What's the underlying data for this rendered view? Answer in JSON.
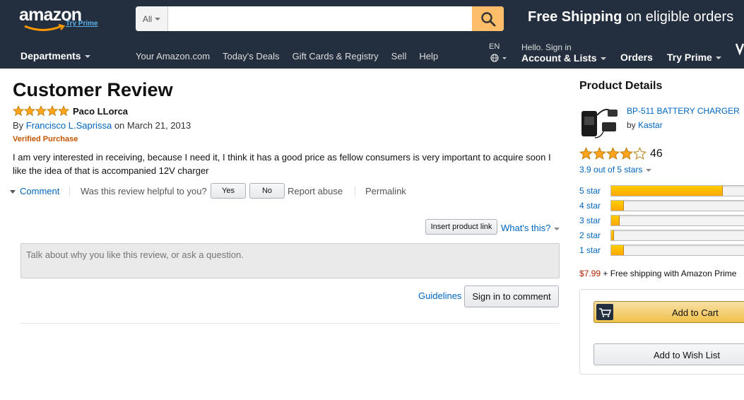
{
  "header": {
    "logo_text": "amazon",
    "logo_tagline": "Try Prime",
    "search_category": "All",
    "search_placeholder": "",
    "promo_bold": "Free Shipping",
    "promo_rest": " on eligible orders",
    "departments": "Departments",
    "nav_links": [
      "Your Amazon.com",
      "Today's Deals",
      "Gift Cards & Registry",
      "Sell",
      "Help"
    ],
    "language": "EN",
    "account_greeting": "Hello. Sign in",
    "account_label": "Account & Lists",
    "orders": "Orders",
    "try_prime": "Try Prime"
  },
  "review": {
    "page_title": "Customer Review",
    "rating": 5,
    "headline": "Paco LLorca",
    "by": "By",
    "author": "Francisco L.Saprissa",
    "date_text": "on March 21, 2013",
    "verified": "Verified Purchase",
    "body_line1": "I am very interested in receiving, because I need it, I think it has a good price as fellow consumers is very important to acquire soon I",
    "body_line2": "like the idea of that is accompanied 12V charger",
    "comment_link": "Comment",
    "helpful_question": "Was this review helpful to you?",
    "yes": "Yes",
    "no": "No",
    "report_abuse": "Report abuse",
    "permalink": "Permalink"
  },
  "comment_form": {
    "insert_product_link": "Insert product link",
    "whats_this": "What's this?",
    "placeholder": "Talk about why you like this review, or ask a question.",
    "guidelines": "Guidelines",
    "sign_in": "Sign in to comment"
  },
  "product": {
    "section_title": "Product Details",
    "name": "BP-511 BATTERY CHARGER",
    "by": "by",
    "brand": "Kastar",
    "rating": 3.9,
    "review_count": "46",
    "out_of": "3.9 out of 5 stars",
    "histogram": [
      {
        "label": "5 star",
        "fraction": 0.8
      },
      {
        "label": "4 star",
        "fraction": 0.09
      },
      {
        "label": "3 star",
        "fraction": 0.06
      },
      {
        "label": "2 star",
        "fraction": 0.02
      },
      {
        "label": "1 star",
        "fraction": 0.09
      }
    ],
    "price": "$7.99",
    "shipping": " + Free shipping with Amazon Prime",
    "add_to_cart": "Add to Cart",
    "add_to_wish_list": "Add to Wish List"
  },
  "colors": {
    "nav_bg": "#232f3e",
    "link": "#0066c0",
    "star": "#ffa41c",
    "verified": "#c45500",
    "price": "#b12704",
    "search_button": "#febd69"
  }
}
